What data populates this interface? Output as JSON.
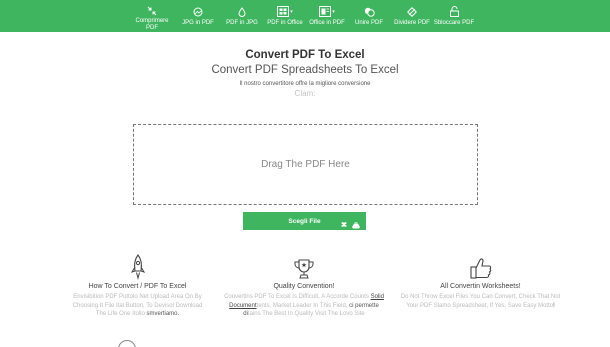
{
  "nav": {
    "items": [
      {
        "label": "Comprimere PDF",
        "icon": "compress-icon"
      },
      {
        "label": "JPG in PDF",
        "icon": "image-icon"
      },
      {
        "label": "PDF in JPG",
        "icon": "drop-icon"
      },
      {
        "label": "PDF in Office",
        "icon": "office-grid-icon"
      },
      {
        "label": "Office in PDF",
        "icon": "office-doc-icon"
      },
      {
        "label": "Unire PDF",
        "icon": "merge-icon"
      },
      {
        "label": "Dividere PDF",
        "icon": "split-icon"
      },
      {
        "label": "Sbloccare PDF",
        "icon": "unlock-icon"
      }
    ]
  },
  "header": {
    "title": "Convert PDF To Excel",
    "subtitle": "Convert PDF Spreadsheets To Excel",
    "tagline": "Il nostro convertitore offre la migliore conversione",
    "ghost": "Clam:"
  },
  "dropzone": {
    "text": "Drag The PDF Here"
  },
  "choose_button": {
    "label": "Scegli File"
  },
  "features": [
    {
      "title": "How To Convert / PDF To Excel",
      "desc_a": "Envisibition PDF Puttolo Net Upload Area On By Choosing It File Ital Button, To Devisol Download The Life One Itollo",
      "desc_b": "smvertiamo."
    },
    {
      "title": "Quality Convention!",
      "desc_a": "Convertins PDF To Excel Is Difficult, A Accorde Counts",
      "desc_link": "Solid Document",
      "desc_b": "tents, Market Leader In This Field,",
      "desc_c": "ci permette di",
      "desc_d": "tains The Best In Quality Visit The Lovo Site"
    },
    {
      "title": "All Convertin Worksheets!",
      "desc_a": "Do Not Throw Excel Files You Can Convert, Check That Not Your PDF Slamo Spreadsheet, If Yes, Save Easy Motto",
      "desc_b": "!"
    }
  ],
  "colors": {
    "accent": "#3fb55f"
  }
}
